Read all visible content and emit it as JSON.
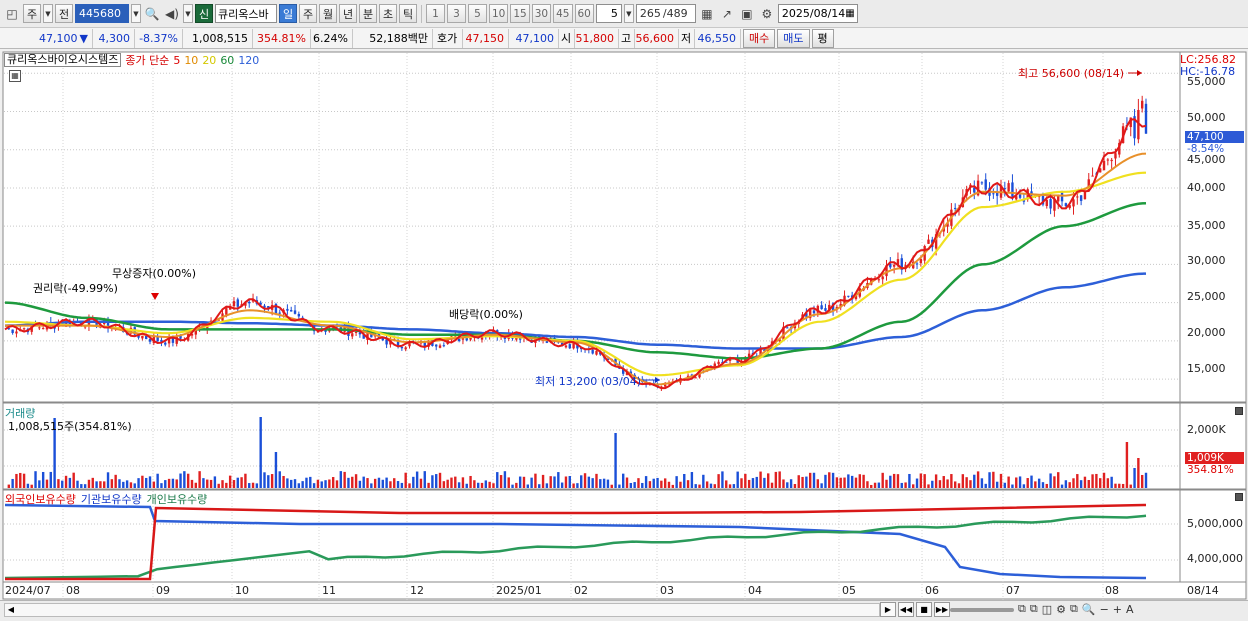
{
  "toolbar": {
    "period_type": "주",
    "prev_label": "전",
    "code": "445680",
    "new_badge": "신",
    "stock_name": "큐리옥스바",
    "periods": [
      "일",
      "주",
      "월",
      "년",
      "분",
      "초",
      "틱"
    ],
    "active_period": "일",
    "intervals": [
      "1",
      "3",
      "5",
      "10",
      "15",
      "30",
      "45",
      "60"
    ],
    "period_count": "5",
    "page_current": "265",
    "page_total": "/489",
    "date": "2025/08/14"
  },
  "quote": {
    "price": "47,100",
    "change_arrow": "▼",
    "change": "4,300",
    "change_pct": "-8.37%",
    "volume": "1,008,515",
    "volume_ratio": "354.81%",
    "turnover": "6.24%",
    "trade_value": "52,188백만",
    "hoga_label": "호가",
    "ask": "47,150",
    "bid": "47,100",
    "open_label": "시",
    "open": "51,800",
    "high_label": "고",
    "high": "56,600",
    "low_label": "저",
    "low": "46,550",
    "buy_label": "매수",
    "sell_label": "매도",
    "avg_label": "평"
  },
  "legend": {
    "stock": "큐리옥스바이오시스템즈",
    "ma_label": "종가 단순",
    "ma5": "5",
    "ma10": "10",
    "ma20": "20",
    "ma60": "60",
    "ma120": "120"
  },
  "annotations": {
    "lc": "LC:256.82",
    "hc": "HC:-16.78",
    "high": "최고 56,600 (08/14)",
    "low": "최저 13,200 (03/04)",
    "rights": "권리락(-49.99%)",
    "bonus": "무상증자(0.00%)",
    "dividend": "배당락(0.00%)",
    "price_tag": "47,100",
    "pct_tag": "-8.54%",
    "vol_tag": "1,009K",
    "vol_pct": "354.81%"
  },
  "price_axis": [
    "55,000",
    "50,000",
    "45,000",
    "40,000",
    "35,000",
    "30,000",
    "25,000",
    "20,000",
    "15,000"
  ],
  "volume_panel": {
    "title": "거래량",
    "value": "1,008,515주(354.81%)",
    "axis": [
      "2,000K",
      "1,000K"
    ]
  },
  "holdings_panel": {
    "foreign": "외국인보유수량",
    "institution": "기관보유수량",
    "individual": "개인보유수량",
    "axis": [
      "5,000,000",
      "4,000,000"
    ]
  },
  "x_axis": [
    "2024/07",
    "08",
    "09",
    "10",
    "11",
    "12",
    "2025/01",
    "02",
    "03",
    "04",
    "05",
    "06",
    "07",
    "08",
    "08/14"
  ],
  "colors": {
    "up": "#e02020",
    "down": "#1a4fd8",
    "ma5": "#e01818",
    "ma10": "#e8902a",
    "ma20": "#f0e020",
    "ma60": "#1e9a3e",
    "ma120": "#2d5fd8"
  },
  "chart_data": {
    "type": "line",
    "x": [
      "2024/07",
      "2024/08",
      "2024/09",
      "2024/10",
      "2024/11",
      "2024/12",
      "2025/01",
      "2025/02",
      "2025/03",
      "2025/04",
      "2025/05",
      "2025/06",
      "2025/07",
      "2025/08",
      "2025/08/14"
    ],
    "series": [
      {
        "name": "5",
        "values": [
          21500,
          22500,
          20000,
          25000,
          21500,
          19500,
          21000,
          19500,
          14000,
          17500,
          24000,
          30000,
          40000,
          38000,
          49000
        ]
      },
      {
        "name": "10",
        "values": [
          22000,
          22000,
          20500,
          24000,
          22000,
          19800,
          20800,
          19800,
          14300,
          17000,
          23500,
          29500,
          39500,
          39000,
          44500
        ]
      },
      {
        "name": "20",
        "values": [
          22500,
          22000,
          21000,
          23000,
          22500,
          20200,
          20600,
          20000,
          15500,
          16800,
          22500,
          28000,
          37500,
          39500,
          42000
        ]
      },
      {
        "name": "60",
        "values": [
          25000,
          23000,
          21500,
          21500,
          21500,
          20800,
          20800,
          20000,
          18500,
          17700,
          19000,
          22500,
          30000,
          35000,
          38000
        ]
      },
      {
        "name": "120",
        "values": [
          22000,
          22500,
          22500,
          22300,
          22000,
          21500,
          21000,
          20500,
          19500,
          19000,
          19000,
          20500,
          24000,
          27000,
          28800
        ]
      }
    ],
    "ylim": [
      12000,
      57000
    ],
    "price_high": 56600,
    "price_low": 13200
  }
}
